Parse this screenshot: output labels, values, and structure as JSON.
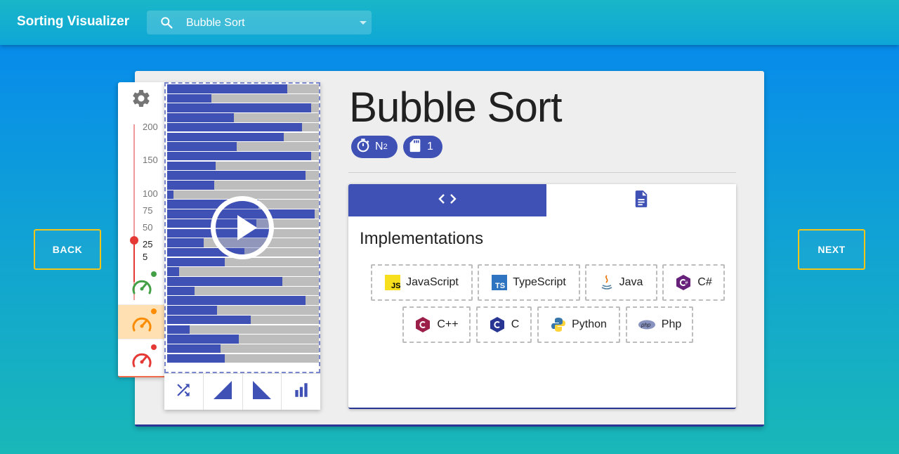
{
  "header": {
    "title": "Sorting Visualizer",
    "search_icon": "search-icon",
    "algorithm_select_value": "Bubble Sort"
  },
  "nav": {
    "back_label": "BACK",
    "next_label": "NEXT"
  },
  "controls": {
    "gear_icon": "gear-icon",
    "size_ticks": [
      "200",
      "150",
      "100",
      "75",
      "50",
      "25",
      "5"
    ],
    "selected_size": "25",
    "speeds": [
      {
        "name": "slow",
        "color": "#43a047"
      },
      {
        "name": "medium",
        "color": "#fb8c00",
        "selected": true
      },
      {
        "name": "fast",
        "color": "#e53935"
      }
    ]
  },
  "bars": {
    "bar_color": "#3f51b5",
    "track_color": "#bdbdbd",
    "fractions": [
      0.79,
      0.29,
      0.95,
      0.44,
      0.89,
      0.77,
      0.46,
      0.95,
      0.32,
      0.91,
      0.31,
      0.04,
      0.6,
      0.97,
      0.59,
      0.69,
      0.24,
      0.51,
      0.38,
      0.08,
      0.76,
      0.18,
      0.91,
      0.33,
      0.55,
      0.15,
      0.47,
      0.35,
      0.38
    ],
    "tools": [
      "shuffle-icon",
      "ascending-icon",
      "descending-icon",
      "bar-chart-icon"
    ]
  },
  "details": {
    "title": "Bubble Sort",
    "time_complexity_base": "N",
    "time_complexity_exp": "2",
    "space_complexity": "1",
    "tabs": [
      "code-icon",
      "document-icon"
    ],
    "implementations_heading": "Implementations",
    "languages": [
      "JavaScript",
      "TypeScript",
      "Java",
      "C#",
      "C++",
      "C",
      "Python",
      "Php"
    ]
  },
  "colors": {
    "primary": "#3f51b5",
    "accent_border": "#f5c518"
  }
}
